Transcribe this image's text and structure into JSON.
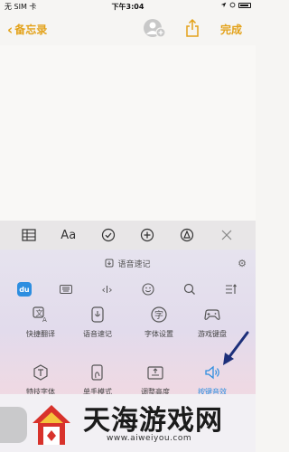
{
  "status": {
    "carrier": "无 SIM 卡",
    "time": "下午3:04"
  },
  "nav": {
    "back_label": "备忘录",
    "done_label": "完成"
  },
  "format_toolbar": {
    "text_style": "Aa"
  },
  "keyboard": {
    "voice_label": "语音速记",
    "tiles": [
      {
        "label": "快捷翻译",
        "icon": "translate-icon"
      },
      {
        "label": "语音速记",
        "icon": "voice-note-icon"
      },
      {
        "label": "字体设置",
        "icon": "font-settings-icon"
      },
      {
        "label": "游戏键盘",
        "icon": "gamepad-icon"
      },
      {
        "label": "特技字体",
        "icon": "special-font-icon"
      },
      {
        "label": "单手模式",
        "icon": "one-hand-icon"
      },
      {
        "label": "调整高度",
        "icon": "adjust-height-icon"
      },
      {
        "label": "按键音效",
        "icon": "speaker-icon"
      }
    ]
  },
  "watermark": {
    "title": "天海游戏网",
    "url": "www.aiweiyou.com"
  },
  "colors": {
    "accent": "#e3a21a",
    "highlight": "#2d8ee0",
    "arrow": "#1c2f7a"
  }
}
